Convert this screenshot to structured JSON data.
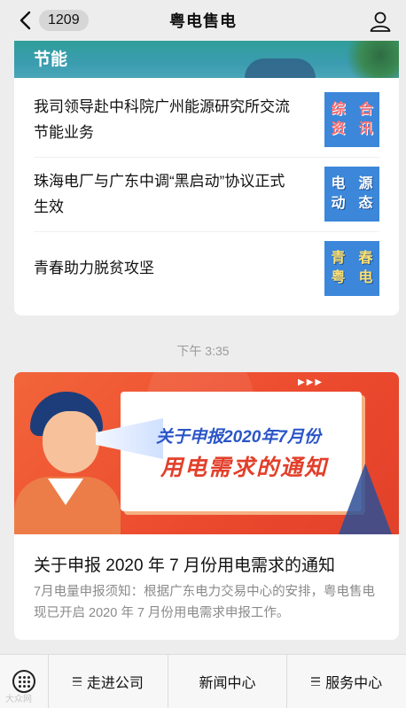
{
  "nav": {
    "back_count": "1209",
    "title": "粤电售电"
  },
  "card1": {
    "banner_label": "节能",
    "items": [
      {
        "text": "我司领导赴中科院广州能源研究所交流节能业务",
        "thumb": [
          "综",
          "合",
          "资",
          "讯"
        ]
      },
      {
        "text": "珠海电厂与广东中调“黑启动”协议正式生效",
        "thumb": [
          "电",
          "源",
          "动",
          "态"
        ]
      },
      {
        "text": "青春助力脱贫攻坚",
        "thumb": [
          "青",
          "春",
          "粤",
          "电"
        ]
      }
    ]
  },
  "timestamp": "下午 3:35",
  "card2": {
    "hero_line1": "关于申报2020年7月份",
    "hero_line2": "用电需求的通知",
    "title": "关于申报 2020 年 7 月份用电需求的通知",
    "description": "7月电量申报须知：根据广东电力交易中心的安排，粤电售电现已开启 2020 年 7 月份用电需求申报工作。"
  },
  "tabbar": {
    "tabs": [
      "走进公司",
      "新闻中心",
      "服务中心"
    ]
  },
  "watermark": "大众网"
}
